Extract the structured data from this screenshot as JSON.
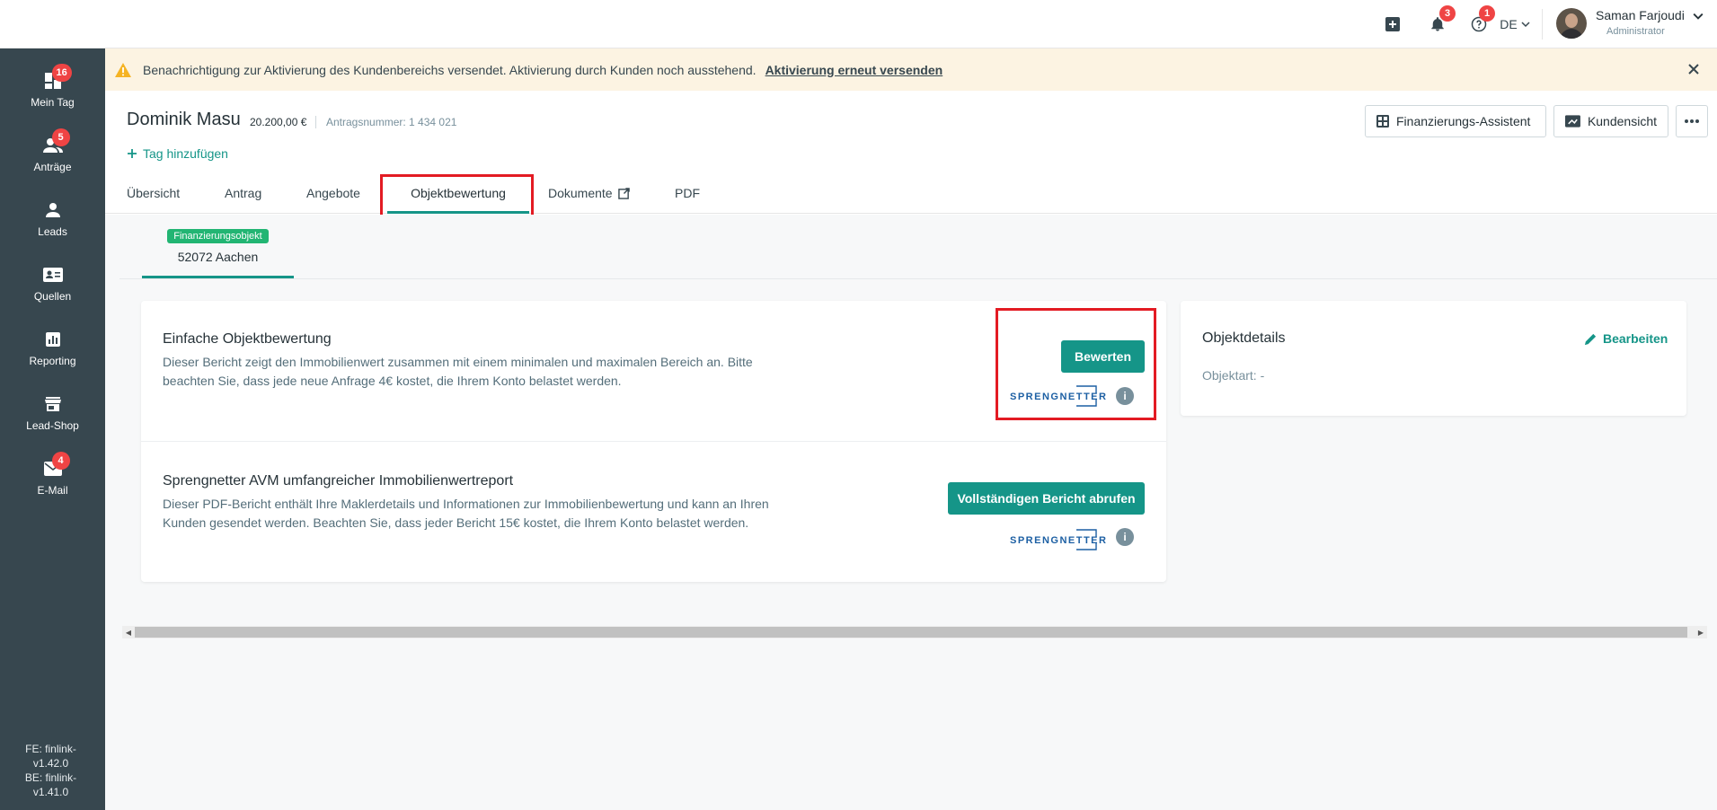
{
  "topbar": {
    "notifications_count": "3",
    "help_count": "1",
    "language": "DE",
    "user_name": "Saman Farjoudi",
    "user_role": "Administrator"
  },
  "sidebar": {
    "items": [
      {
        "label": "Mein Tag",
        "badge": "16",
        "icon": "dashboard-icon"
      },
      {
        "label": "Anträge",
        "badge": "5",
        "icon": "users-icon"
      },
      {
        "label": "Leads",
        "badge": "",
        "icon": "person-icon"
      },
      {
        "label": "Quellen",
        "badge": "",
        "icon": "contact-card-icon"
      },
      {
        "label": "Reporting",
        "badge": "",
        "icon": "chart-icon"
      },
      {
        "label": "Lead-Shop",
        "badge": "",
        "icon": "store-icon"
      },
      {
        "label": "E-Mail",
        "badge": "4",
        "icon": "mail-icon"
      }
    ],
    "version_lines": [
      "FE: finlink-",
      "v1.42.0",
      "BE: finlink-",
      "v1.41.0"
    ]
  },
  "banner": {
    "text": "Benachrichtigung zur Aktivierung des Kundenbereichs versendet. Aktivierung durch Kunden noch ausstehend.",
    "link": "Aktivierung erneut versenden"
  },
  "header": {
    "customer_name": "Dominik Masu",
    "amount": "20.200,00 €",
    "antrag": "Antragsnummer: 1 434 021",
    "add_tag": "Tag hinzufügen",
    "btn_finanzierung": "Finanzierungs-Assistent",
    "btn_kundensicht": "Kundensicht"
  },
  "tabs": [
    "Übersicht",
    "Antrag",
    "Angebote",
    "Objektbewertung",
    "Dokumente",
    "PDF"
  ],
  "subtab": {
    "badge": "Finanzierungsobjekt",
    "label": "52072 Aachen"
  },
  "simple": {
    "title": "Einfache Objektbewertung",
    "desc_line1": "Dieser Bericht zeigt den Immobilienwert zusammen mit einem minimalen und maximalen Bereich an. Bitte",
    "desc_line2": "beachten Sie, dass jede neue Anfrage 4€ kostet, die Ihrem Konto belastet werden.",
    "button": "Bewerten"
  },
  "avm": {
    "title": "Sprengnetter AVM umfangreicher Immobilienwertreport",
    "desc_line1": "Dieser PDF-Bericht enthält Ihre Maklerdetails und Informationen zur Immobilienbewertung und kann an Ihren",
    "desc_line2": "Kunden gesendet werden. Beachten Sie, dass jeder Bericht 15€ kostet, die Ihrem Konto belastet werden.",
    "button": "Vollständigen Bericht abrufen"
  },
  "brand": "SPRENGNETTER",
  "info_glyph": "i",
  "details": {
    "title": "Objektdetails",
    "edit": "Bearbeiten",
    "objektart": "Objektart:  -"
  },
  "colors": {
    "primary": "#159588",
    "sidebar": "#37474f",
    "badge": "#ef4444",
    "highlight": "#e31b23"
  }
}
